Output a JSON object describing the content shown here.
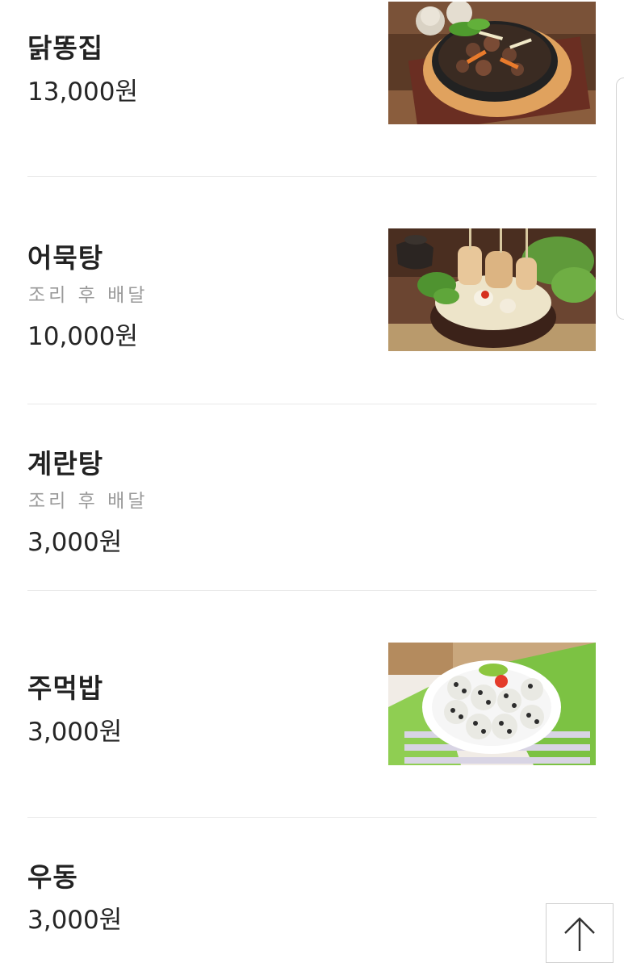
{
  "menu": {
    "items": [
      {
        "name": "닭똥집",
        "desc": "",
        "price": "13,000원",
        "photo": "stir-fried-chicken-gizzard-photo"
      },
      {
        "name": "어묵탕",
        "desc": "조리 후 배달",
        "price": "10,000원",
        "photo": "fish-cake-soup-photo"
      },
      {
        "name": "계란탕",
        "desc": "조리 후 배달",
        "price": "3,000원",
        "photo": ""
      },
      {
        "name": "주먹밥",
        "desc": "",
        "price": "3,000원",
        "photo": "rice-ball-photo"
      },
      {
        "name": "우동",
        "desc": "",
        "price": "3,000원",
        "photo": ""
      }
    ]
  },
  "controls": {
    "scroll_top_icon": "arrow-up-icon"
  }
}
